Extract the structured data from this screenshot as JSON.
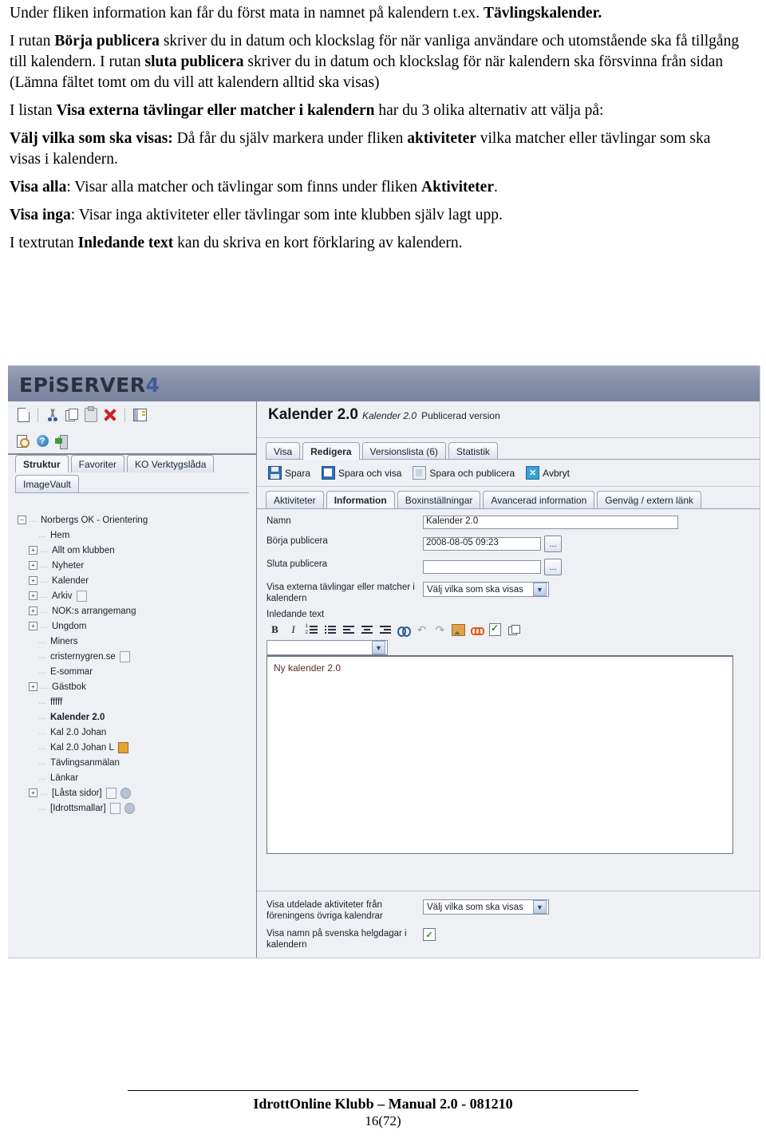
{
  "document": {
    "paragraphs": [
      {
        "runs": [
          {
            "t": "Under fliken information kan får du först mata in namnet på kalendern t.ex. ",
            "b": false
          },
          {
            "t": "Tävlingskalender.",
            "b": true
          }
        ]
      },
      {
        "runs": [
          {
            "t": "I rutan ",
            "b": false
          },
          {
            "t": "Börja publicera",
            "b": true
          },
          {
            "t": " skriver du in datum och klockslag för när vanliga användare och utomstående ska få tillgång till kalendern. I rutan ",
            "b": false
          },
          {
            "t": "sluta publicera",
            "b": true
          },
          {
            "t": " skriver du in datum och klockslag för när kalendern ska försvinna från sidan (Lämna fältet tomt om du vill att kalendern alltid ska visas)",
            "b": false
          }
        ]
      },
      {
        "runs": [
          {
            "t": "I listan ",
            "b": false
          },
          {
            "t": "Visa externa tävlingar eller matcher i kalendern",
            "b": true
          },
          {
            "t": " har du 3 olika alternativ att välja på:",
            "b": false
          }
        ]
      },
      {
        "runs": [
          {
            "t": "Välj vilka som ska visas:",
            "b": true
          },
          {
            "t": " Då får du själv markera under fliken ",
            "b": false
          },
          {
            "t": "aktiviteter",
            "b": true
          },
          {
            "t": " vilka matcher eller tävlingar som ska visas i kalendern.",
            "b": false
          }
        ]
      },
      {
        "runs": [
          {
            "t": "Visa alla",
            "b": true
          },
          {
            "t": ": Visar alla matcher och tävlingar som finns under fliken ",
            "b": false
          },
          {
            "t": "Aktiviteter",
            "b": true
          },
          {
            "t": ".",
            "b": false
          }
        ]
      },
      {
        "runs": [
          {
            "t": "Visa inga",
            "b": true
          },
          {
            "t": ": Visar inga aktiviteter eller tävlingar som inte klubben själv lagt upp.",
            "b": false
          }
        ]
      },
      {
        "runs": [
          {
            "t": "I textrutan ",
            "b": false
          },
          {
            "t": "Inledande text",
            "b": true
          },
          {
            "t": " kan du skriva en kort förklaring av kalendern.",
            "b": false
          }
        ]
      }
    ]
  },
  "screenshot": {
    "logo": {
      "word": "EPiSERVER",
      "version": "4"
    },
    "left_toolbar_row1": [
      {
        "name": "new-page-icon",
        "label": "Ny sida"
      },
      {
        "name": "cut-icon",
        "label": "Klipp ut"
      },
      {
        "name": "copy-icon",
        "label": "Kopiera"
      },
      {
        "name": "paste-icon",
        "label": "Klistra in"
      },
      {
        "name": "delete-icon",
        "label": "Ta bort"
      },
      {
        "name": "panel-icon",
        "label": "Visa panel"
      }
    ],
    "left_toolbar_row2": [
      {
        "name": "preview-icon",
        "label": "Förhandsgranska"
      },
      {
        "name": "help-icon",
        "label": "Hjälp"
      },
      {
        "name": "logout-icon",
        "label": "Logga ut"
      }
    ],
    "left_tabs_row1": [
      {
        "label": "Struktur",
        "active": true
      },
      {
        "label": "Favoriter",
        "active": false
      },
      {
        "label": "KO Verktygslåda",
        "active": false
      }
    ],
    "left_tabs_row2": [
      {
        "label": "ImageVault",
        "active": false
      }
    ],
    "tree": [
      {
        "label": "Norbergs OK - Orientering",
        "indent": 0,
        "expander": "minus",
        "bold": false,
        "badges": []
      },
      {
        "label": "Hem",
        "indent": 1,
        "expander": "none",
        "bold": false,
        "badges": []
      },
      {
        "label": "Allt om klubben",
        "indent": 1,
        "expander": "plus",
        "bold": false,
        "badges": []
      },
      {
        "label": "Nyheter",
        "indent": 1,
        "expander": "plus",
        "bold": false,
        "badges": []
      },
      {
        "label": "Kalender",
        "indent": 1,
        "expander": "plus",
        "bold": false,
        "badges": []
      },
      {
        "label": "Arkiv",
        "indent": 1,
        "expander": "plus",
        "bold": false,
        "badges": [
          "page"
        ]
      },
      {
        "label": "NOK:s arrangemang",
        "indent": 1,
        "expander": "plus",
        "bold": false,
        "badges": []
      },
      {
        "label": "Ungdom",
        "indent": 1,
        "expander": "plus",
        "bold": false,
        "badges": []
      },
      {
        "label": "Miners",
        "indent": 1,
        "expander": "none",
        "bold": false,
        "badges": []
      },
      {
        "label": "cristernygren.se",
        "indent": 1,
        "expander": "none",
        "bold": false,
        "badges": [
          "page"
        ]
      },
      {
        "label": "E-sommar",
        "indent": 1,
        "expander": "none",
        "bold": false,
        "badges": []
      },
      {
        "label": "Gästbok",
        "indent": 1,
        "expander": "plus",
        "bold": false,
        "badges": []
      },
      {
        "label": "fffff",
        "indent": 1,
        "expander": "none",
        "bold": false,
        "badges": []
      },
      {
        "label": "Kalender 2.0",
        "indent": 1,
        "expander": "none",
        "bold": true,
        "badges": []
      },
      {
        "label": "Kal 2.0 Johan",
        "indent": 1,
        "expander": "none",
        "bold": false,
        "badges": []
      },
      {
        "label": "Kal 2.0 Johan L",
        "indent": 1,
        "expander": "none",
        "bold": false,
        "badges": [
          "lock"
        ]
      },
      {
        "label": "Tävlingsanmälan",
        "indent": 1,
        "expander": "none",
        "bold": false,
        "badges": []
      },
      {
        "label": "Länkar",
        "indent": 1,
        "expander": "none",
        "bold": false,
        "badges": []
      },
      {
        "label": "[Låsta sidor]",
        "indent": 1,
        "expander": "plus",
        "bold": false,
        "badges": [
          "page",
          "globe"
        ]
      },
      {
        "label": "[Idrottsmallar]",
        "indent": 1,
        "expander": "none",
        "bold": false,
        "badges": [
          "page",
          "globe"
        ]
      }
    ],
    "page_header": {
      "title": "Kalender 2.0",
      "subtitle_italic": "Kalender 2.0",
      "status": "Publicerad version"
    },
    "page_tabs": [
      {
        "label": "Visa",
        "active": false
      },
      {
        "label": "Redigera",
        "active": true
      },
      {
        "label": "Versionslista (6)",
        "active": false
      },
      {
        "label": "Statistik",
        "active": false
      }
    ],
    "actions": [
      {
        "label": "Spara",
        "icon": "save-icon"
      },
      {
        "label": "Spara och visa",
        "icon": "save-and-view-icon"
      },
      {
        "label": "Spara och publicera",
        "icon": "save-and-publish-icon"
      },
      {
        "label": "Avbryt",
        "icon": "cancel-icon"
      }
    ],
    "form_tabs": [
      {
        "label": "Aktiviteter",
        "active": false
      },
      {
        "label": "Information",
        "active": true
      },
      {
        "label": "Boxinställningar",
        "active": false
      },
      {
        "label": "Avancerad information",
        "active": false
      },
      {
        "label": "Genväg / extern länk",
        "active": false
      }
    ],
    "fields": {
      "namn_label": "Namn",
      "namn_value": "Kalender 2.0",
      "borja_label": "Börja publicera",
      "borja_value": "2008-08-05 09:23",
      "sluta_label": "Sluta publicera",
      "sluta_value": "",
      "picker_label": "...",
      "externa_label": "Visa externa tävlingar eller matcher i kalendern",
      "externa_value": "Välj vilka som ska visas",
      "inledande_label": "Inledande text",
      "style_value": "",
      "editor_text": "Ny kalender 2.0",
      "utdelade_label": "Visa utdelade aktiviteter från föreningens övriga kalendrar",
      "utdelade_value": "Välj vilka som ska visas",
      "helgdagar_label": "Visa namn på svenska helgdagar i kalendern",
      "helgdagar_checked": "✓"
    },
    "rte_toolbar": [
      {
        "name": "bold-icon",
        "label": "B"
      },
      {
        "name": "italic-icon",
        "label": "I"
      },
      {
        "name": "ordered-list-icon",
        "label": ""
      },
      {
        "name": "bullet-list-icon",
        "label": ""
      },
      {
        "name": "align-left-icon",
        "label": ""
      },
      {
        "name": "align-center-icon",
        "label": ""
      },
      {
        "name": "align-right-icon",
        "label": ""
      },
      {
        "name": "find-replace-icon",
        "label": ""
      },
      {
        "name": "undo-icon",
        "label": "↶"
      },
      {
        "name": "redo-icon",
        "label": "↷"
      },
      {
        "name": "insert-image-icon",
        "label": ""
      },
      {
        "name": "insert-link-icon",
        "label": ""
      },
      {
        "name": "spellcheck-icon",
        "label": ""
      },
      {
        "name": "new-window-icon",
        "label": ""
      }
    ]
  },
  "footer": {
    "line1": "IdrottOnline Klubb – Manual  2.0 - 081210",
    "line2": "16(72)"
  }
}
